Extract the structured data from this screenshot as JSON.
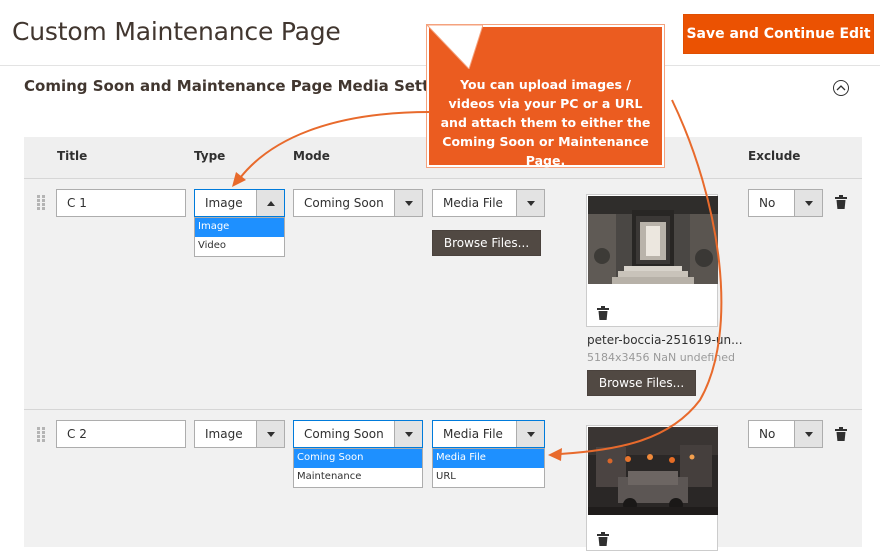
{
  "header": {
    "title": "Custom Maintenance Page",
    "save_label": "Save and Continue Edit"
  },
  "section": {
    "title": "Coming Soon and Maintenance Page Media Settings"
  },
  "grid": {
    "columns": {
      "title": "Title",
      "type": "Type",
      "mode": "Mode",
      "image_partial": "e",
      "exclude": "Exclude"
    },
    "rows": [
      {
        "title_value": "C 1",
        "type_value": "Image",
        "type_options": [
          "Image",
          "Video"
        ],
        "mode_value": "Coming Soon",
        "source_value": "Media File",
        "browse_label": "Browse Files...",
        "file_name": "peter-boccia-251619-un...",
        "file_meta": "5184x3456 NaN undefined",
        "browse_label_2": "Browse Files...",
        "exclude_value": "No"
      },
      {
        "title_value": "C 2",
        "type_value": "Image",
        "mode_value": "Coming Soon",
        "mode_options": [
          "Coming Soon",
          "Maintenance"
        ],
        "source_value": "Media File",
        "source_options": [
          "Media File",
          "URL"
        ],
        "exclude_value": "No"
      }
    ]
  },
  "callout": {
    "text": "You can upload images / videos via your PC or a URL and attach them to either the Coming Soon or Maintenance Page."
  },
  "colors": {
    "accent": "#eb5202",
    "callout": "#eb5c20",
    "browse": "#514943",
    "selected_option": "#1e90ff"
  }
}
